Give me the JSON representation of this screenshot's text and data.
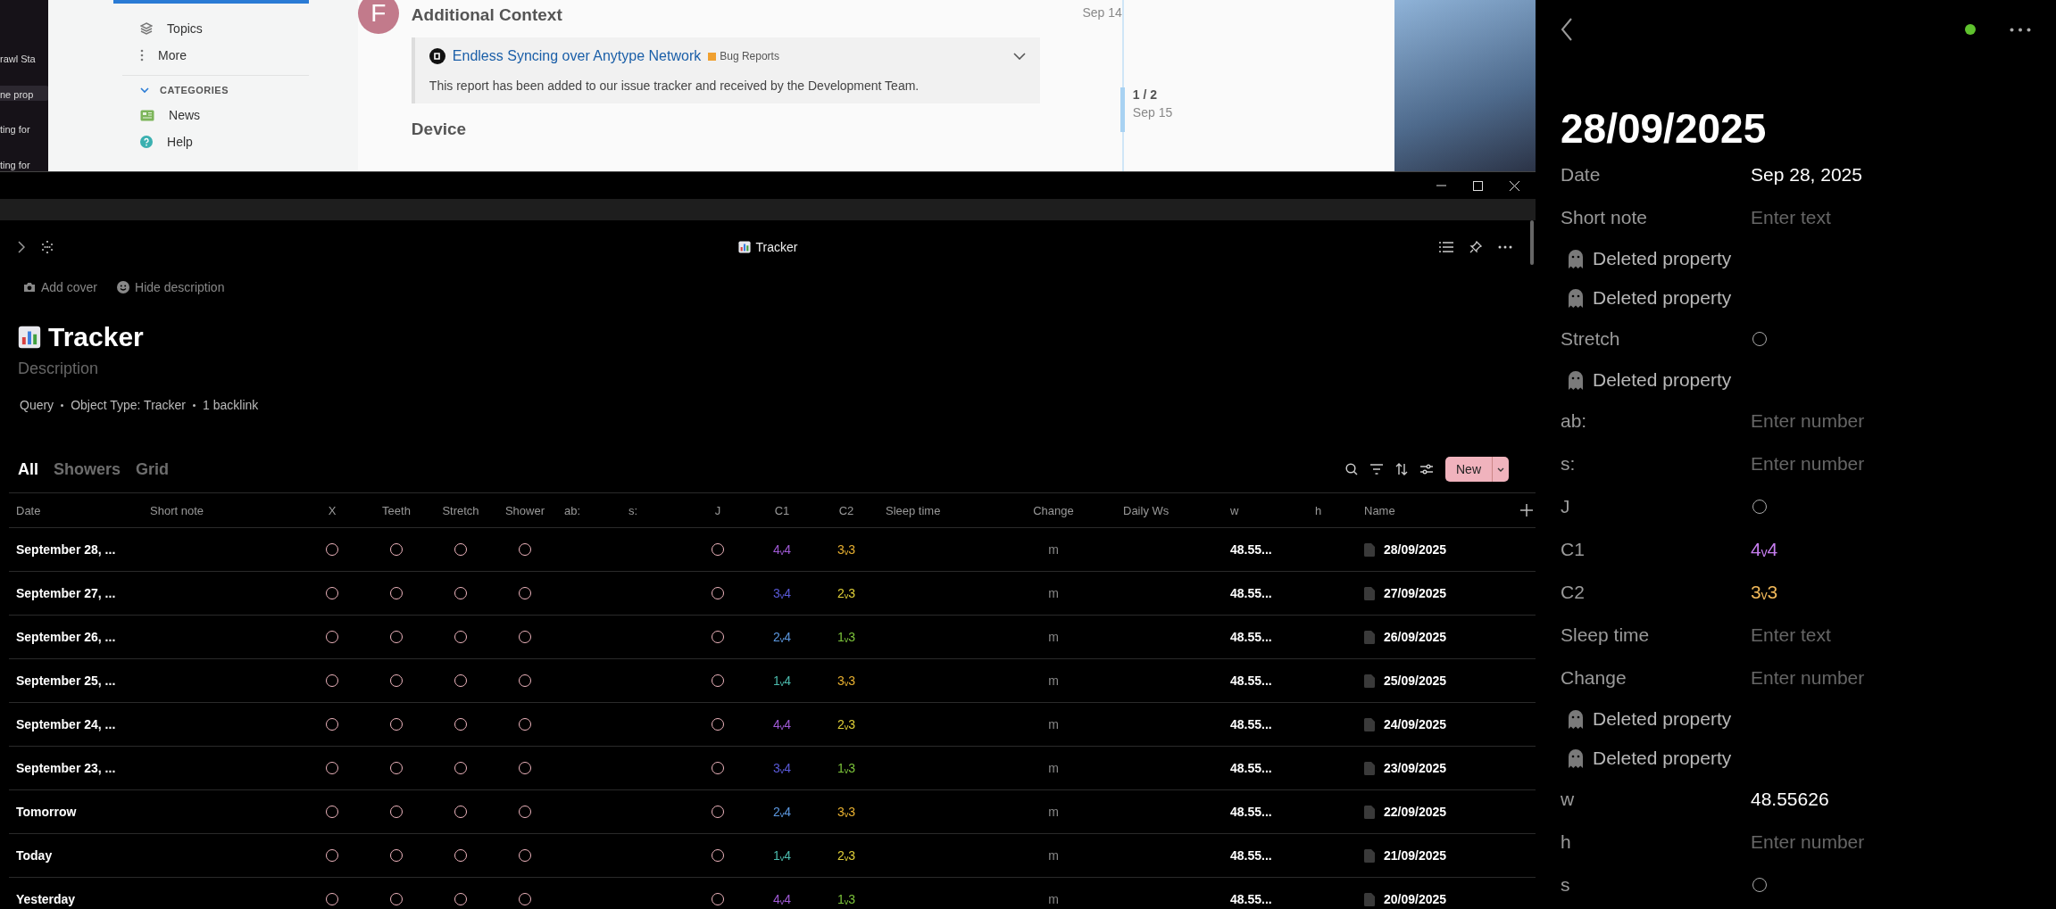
{
  "background": {
    "side_snippets": [
      {
        "label": "rawl Sta",
        "selected": false
      },
      {
        "label": "ne prop",
        "selected": true
      },
      {
        "label": "ting for",
        "selected": false
      },
      {
        "label": "ting for",
        "selected": false
      }
    ],
    "forum_nav": [
      {
        "kind": "topics",
        "label": "Topics"
      },
      {
        "kind": "more",
        "label": "More"
      }
    ],
    "categories_header": "CATEGORIES",
    "categories": [
      {
        "kind": "news",
        "label": "News"
      },
      {
        "kind": "help",
        "label": "Help"
      }
    ],
    "post": {
      "avatar_letter": "F",
      "title": "Additional Context",
      "date": "Sep 14",
      "link_title": "Endless Syncing over Anytype Network",
      "tag": "Bug Reports",
      "body": "This report has been added to our issue tracker and received by the Development Team.",
      "section_heading": "Device"
    },
    "timeline": {
      "position": "1 / 2",
      "date": "Sep 15"
    }
  },
  "header": {
    "title": "Tracker"
  },
  "page": {
    "actions": [
      {
        "kind": "cover",
        "label": "Add cover"
      },
      {
        "kind": "description",
        "label": "Hide description"
      }
    ],
    "title": "Tracker",
    "description_placeholder": "Description",
    "meta": [
      "Query",
      "Object Type: Tracker",
      "1 backlink"
    ],
    "views": [
      {
        "label": "All",
        "selected": true
      },
      {
        "label": "Showers",
        "selected": false
      },
      {
        "label": "Grid",
        "selected": false
      }
    ],
    "new_button": "New"
  },
  "table": {
    "columns": [
      {
        "label": "Date",
        "kind": "date"
      },
      {
        "label": "Short note",
        "kind": "empty"
      },
      {
        "label": "X",
        "kind": "check"
      },
      {
        "label": "Teeth",
        "kind": "check"
      },
      {
        "label": "Stretch",
        "kind": "check"
      },
      {
        "label": "Shower",
        "kind": "check"
      },
      {
        "label": "ab:",
        "kind": "empty"
      },
      {
        "label": "s:",
        "kind": "empty"
      },
      {
        "label": "J",
        "kind": "check"
      },
      {
        "label": "C1",
        "kind": "rating"
      },
      {
        "label": "C2",
        "kind": "rating"
      },
      {
        "label": "Sleep time",
        "kind": "empty"
      },
      {
        "label": "Change",
        "kind": "unit"
      },
      {
        "label": "Daily Ws",
        "kind": "empty"
      },
      {
        "label": "w",
        "kind": "number"
      },
      {
        "label": "h",
        "kind": "empty"
      },
      {
        "label": "Name",
        "kind": "name"
      }
    ],
    "rows": [
      {
        "date": "September 28, ...",
        "x": false,
        "teeth": false,
        "stretch": false,
        "shower": false,
        "j": false,
        "c1": {
          "text": "4ᵥ4",
          "color": "#a05ad6"
        },
        "c2": {
          "text": "3ᵥ3",
          "color": "#e8b030"
        },
        "change": "m",
        "w": "48.55...",
        "name": "28/09/2025"
      },
      {
        "date": "September 27, ...",
        "x": false,
        "teeth": false,
        "stretch": false,
        "shower": false,
        "j": false,
        "c1": {
          "text": "3ᵥ4",
          "color": "#5a5ad8"
        },
        "c2": {
          "text": "2ᵥ3",
          "color": "#e0d038"
        },
        "change": "m",
        "w": "48.55...",
        "name": "27/09/2025"
      },
      {
        "date": "September 26, ...",
        "x": false,
        "teeth": false,
        "stretch": false,
        "shower": false,
        "j": false,
        "c1": {
          "text": "2ᵥ4",
          "color": "#5c98e0"
        },
        "c2": {
          "text": "1ᵥ3",
          "color": "#7cc43a"
        },
        "change": "m",
        "w": "48.55...",
        "name": "26/09/2025"
      },
      {
        "date": "September 25, ...",
        "x": false,
        "teeth": false,
        "stretch": false,
        "shower": false,
        "j": false,
        "c1": {
          "text": "1ᵥ4",
          "color": "#4cbcae"
        },
        "c2": {
          "text": "3ᵥ3",
          "color": "#e8b030"
        },
        "change": "m",
        "w": "48.55...",
        "name": "25/09/2025"
      },
      {
        "date": "September 24, ...",
        "x": false,
        "teeth": false,
        "stretch": false,
        "shower": false,
        "j": false,
        "c1": {
          "text": "4ᵥ4",
          "color": "#a05ad6"
        },
        "c2": {
          "text": "2ᵥ3",
          "color": "#e0d038"
        },
        "change": "m",
        "w": "48.55...",
        "name": "24/09/2025"
      },
      {
        "date": "September 23, ...",
        "x": false,
        "teeth": false,
        "stretch": false,
        "shower": false,
        "j": false,
        "c1": {
          "text": "3ᵥ4",
          "color": "#5a5ad8"
        },
        "c2": {
          "text": "1ᵥ3",
          "color": "#7cc43a"
        },
        "change": "m",
        "w": "48.55...",
        "name": "23/09/2025"
      },
      {
        "date": "Tomorrow",
        "x": false,
        "teeth": false,
        "stretch": false,
        "shower": false,
        "j": false,
        "c1": {
          "text": "2ᵥ4",
          "color": "#5c98e0"
        },
        "c2": {
          "text": "3ᵥ3",
          "color": "#e8b030"
        },
        "change": "m",
        "w": "48.55...",
        "name": "22/09/2025"
      },
      {
        "date": "Today",
        "x": false,
        "teeth": false,
        "stretch": false,
        "shower": false,
        "j": false,
        "c1": {
          "text": "1ᵥ4",
          "color": "#4cbcae"
        },
        "c2": {
          "text": "2ᵥ3",
          "color": "#e0d038"
        },
        "change": "m",
        "w": "48.55...",
        "name": "21/09/2025"
      },
      {
        "date": "Yesterday",
        "x": false,
        "teeth": false,
        "stretch": false,
        "shower": false,
        "j": false,
        "c1": {
          "text": "4ᵥ4",
          "color": "#a05ad6"
        },
        "c2": {
          "text": "1ᵥ3",
          "color": "#7cc43a"
        },
        "change": "m",
        "w": "48.55...",
        "name": "20/09/2025"
      }
    ]
  },
  "detail": {
    "title": "28/09/2025",
    "properties": [
      {
        "kind": "value",
        "label": "Date",
        "value": "Sep 28, 2025"
      },
      {
        "kind": "placeholder",
        "label": "Short note",
        "placeholder": "Enter text"
      },
      {
        "kind": "deleted",
        "label": "Deleted property"
      },
      {
        "kind": "deleted",
        "label": "Deleted property"
      },
      {
        "kind": "check",
        "label": "Stretch",
        "checked": false
      },
      {
        "kind": "deleted",
        "label": "Deleted property"
      },
      {
        "kind": "placeholder",
        "label": "ab:",
        "placeholder": "Enter number"
      },
      {
        "kind": "placeholder",
        "label": "s:",
        "placeholder": "Enter number"
      },
      {
        "kind": "check",
        "label": "J",
        "checked": false
      },
      {
        "kind": "rating",
        "label": "C1",
        "value": "4ᵥ4",
        "color": "#c77ef0"
      },
      {
        "kind": "rating",
        "label": "C2",
        "value": "3ᵥ3",
        "color": "#f0b85a"
      },
      {
        "kind": "placeholder",
        "label": "Sleep time",
        "placeholder": "Enter text"
      },
      {
        "kind": "placeholder",
        "label": "Change",
        "placeholder": "Enter number"
      },
      {
        "kind": "deleted",
        "label": "Deleted property"
      },
      {
        "kind": "deleted",
        "label": "Deleted property"
      },
      {
        "kind": "value",
        "label": "w",
        "value": "48.55626"
      },
      {
        "kind": "placeholder",
        "label": "h",
        "placeholder": "Enter number"
      },
      {
        "kind": "check",
        "label": "s",
        "checked": false
      }
    ]
  }
}
